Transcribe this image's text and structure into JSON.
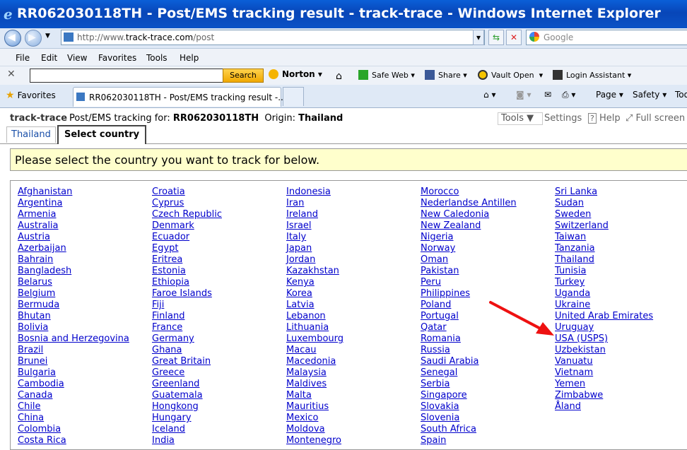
{
  "window": {
    "title": "RR062030118TH - Post/EMS tracking result - track-trace - Windows Internet Explorer"
  },
  "address": {
    "prefix": "http://www.",
    "domain": "track-trace.com",
    "path": "/post"
  },
  "search_engine": {
    "placeholder": "Google"
  },
  "menu": [
    "File",
    "Edit",
    "View",
    "Favorites",
    "Tools",
    "Help"
  ],
  "norton": {
    "search_label": "Search",
    "brand": "Norton",
    "items": [
      "Safe Web",
      "Share",
      "Vault Open",
      "Login Assistant"
    ]
  },
  "tabs": {
    "favorites": "Favorites",
    "active_tab": "RR062030118TH - Post/EMS tracking result -..."
  },
  "commands": [
    "Page",
    "Safety",
    "Tools"
  ],
  "page": {
    "brand": "track-trace",
    "tracking_label": "Post/EMS tracking for:",
    "tracking_number": "RR062030118TH",
    "origin_label": "Origin:",
    "origin": "Thailand",
    "tools_btn": "Tools",
    "links": [
      "Settings",
      "Help",
      "Full screen"
    ],
    "country_tabs": [
      "Thailand",
      "Select country"
    ],
    "instruction": "Please select the country you want to track for below."
  },
  "countries": [
    [
      "Afghanistan",
      "Argentina",
      "Armenia",
      "Australia",
      "Austria",
      "Azerbaijan",
      "Bahrain",
      "Bangladesh",
      "Belarus",
      "Belgium",
      "Bermuda",
      "Bhutan",
      "Bolivia",
      "Bosnia and Herzegovina",
      "Brazil",
      "Brunei",
      "Bulgaria",
      "Cambodia",
      "Canada",
      "Chile",
      "China",
      "Colombia",
      "Costa Rica"
    ],
    [
      "Croatia",
      "Cyprus",
      "Czech Republic",
      "Denmark",
      "Ecuador",
      "Egypt",
      "Eritrea",
      "Estonia",
      "Ethiopia",
      "Faroe Islands",
      "Fiji",
      "Finland",
      "France",
      "Germany",
      "Ghana",
      "Great Britain",
      "Greece",
      "Greenland",
      "Guatemala",
      "Hongkong",
      "Hungary",
      "Iceland",
      "India"
    ],
    [
      "Indonesia",
      "Iran",
      "Ireland",
      "Israel",
      "Italy",
      "Japan",
      "Jordan",
      "Kazakhstan",
      "Kenya",
      "Korea",
      "Latvia",
      "Lebanon",
      "Lithuania",
      "Luxembourg",
      "Macau",
      "Macedonia",
      "Malaysia",
      "Maldives",
      "Malta",
      "Mauritius",
      "Mexico",
      "Moldova",
      "Montenegro"
    ],
    [
      "Morocco",
      "Nederlandse Antillen",
      "New Caledonia",
      "New Zealand",
      "Nigeria",
      "Norway",
      "Oman",
      "Pakistan",
      "Peru",
      "Philippines",
      "Poland",
      "Portugal",
      "Qatar",
      "Romania",
      "Russia",
      "Saudi Arabia",
      "Senegal",
      "Serbia",
      "Singapore",
      "Slovakia",
      "Slovenia",
      "South Africa",
      "Spain"
    ],
    [
      "Sri Lanka",
      "Sudan",
      "Sweden",
      "Switzerland",
      "Taiwan",
      "Tanzania",
      "Thailand",
      "Tunisia",
      "Turkey",
      "Uganda",
      "Ukraine",
      "United Arab Emirates",
      "Uruguay",
      "USA (USPS)",
      "Uzbekistan",
      "Vanuatu",
      "Vietnam",
      "Yemen",
      "Zimbabwe",
      "Åland"
    ]
  ],
  "annotation": {
    "arrow_color": "#ee1111"
  }
}
